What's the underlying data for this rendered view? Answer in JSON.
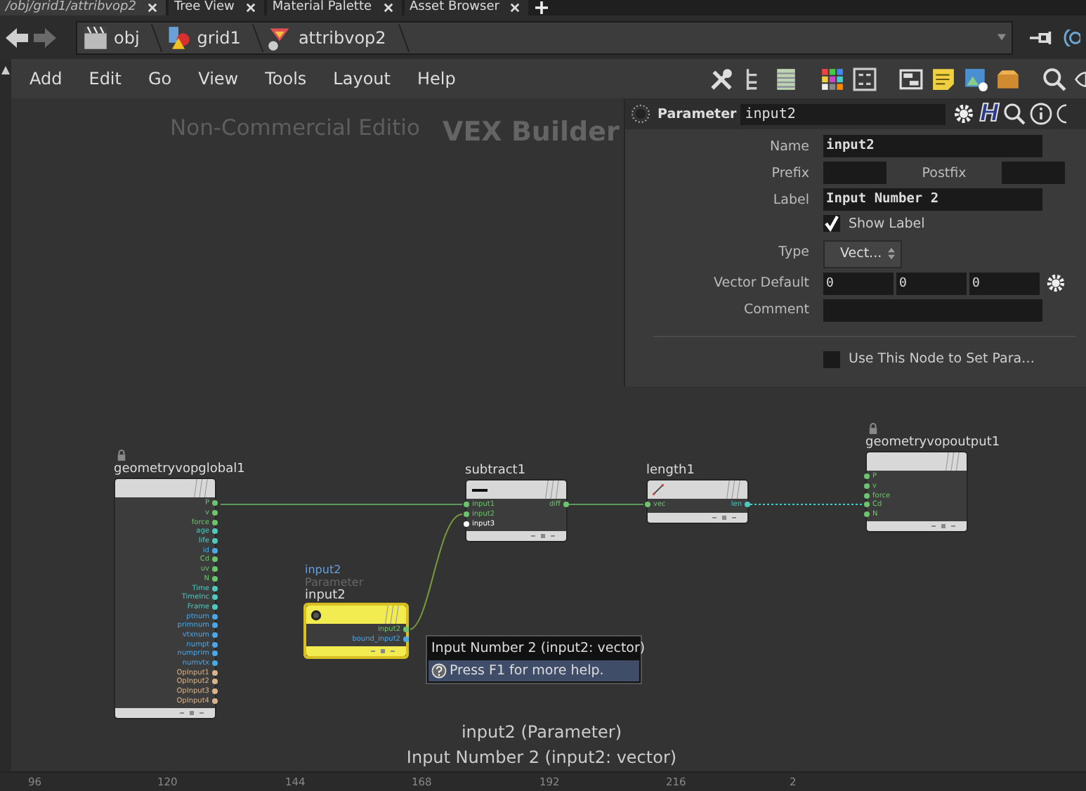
{
  "tabs": [
    {
      "label": "/obj/grid1/attribvop2",
      "selected": true
    },
    {
      "label": "Tree View",
      "selected": false
    },
    {
      "label": "Material Palette",
      "selected": false
    },
    {
      "label": "Asset Browser",
      "selected": false
    }
  ],
  "path": [
    "obj",
    "grid1",
    "attribvop2"
  ],
  "menu": [
    "Add",
    "Edit",
    "Go",
    "View",
    "Tools",
    "Layout",
    "Help"
  ],
  "canvas": {
    "watermark": "Non-Commercial Editio",
    "context": "VEX Builder"
  },
  "parameter_panel": {
    "type_label": "Parameter",
    "node_name": "input2",
    "hda_glyph": "H",
    "name": {
      "label": "Name",
      "value": "input2"
    },
    "prefix": {
      "label": "Prefix"
    },
    "postfix": {
      "label": "Postfix"
    },
    "label": {
      "label": "Label",
      "value": "Input Number 2"
    },
    "show_label": {
      "label": "Show Label",
      "checked": true
    },
    "type": {
      "label": "Type",
      "value": "Vect..."
    },
    "vector_default": {
      "label": "Vector Default",
      "values": [
        "0",
        "0",
        "0"
      ]
    },
    "comment": {
      "label": "Comment"
    },
    "use_node": {
      "label": "Use This Node to Set Para…",
      "checked": false
    }
  },
  "nodes": [
    {
      "name": "geometryvopglobal1",
      "kind": "global",
      "locked": true,
      "selected": false,
      "outputs": [
        {
          "name": "P",
          "color": "#6cc46c"
        },
        {
          "name": "v",
          "color": "#6cc46c"
        },
        {
          "name": "force",
          "color": "#6cc46c"
        },
        {
          "name": "age",
          "color": "#4fc9c0"
        },
        {
          "name": "life",
          "color": "#4fc9c0"
        },
        {
          "name": "id",
          "color": "#4aa8e8"
        },
        {
          "name": "Cd",
          "color": "#6cc46c"
        },
        {
          "name": "uv",
          "color": "#6cc46c"
        },
        {
          "name": "N",
          "color": "#6cc46c"
        },
        {
          "name": "Time",
          "color": "#4fc9c0"
        },
        {
          "name": "TimeInc",
          "color": "#4fc9c0"
        },
        {
          "name": "Frame",
          "color": "#4fc9c0"
        },
        {
          "name": "ptnum",
          "color": "#4aa8e8"
        },
        {
          "name": "primnum",
          "color": "#4aa8e8"
        },
        {
          "name": "vtxnum",
          "color": "#4aa8e8"
        },
        {
          "name": "numpt",
          "color": "#4aa8e8"
        },
        {
          "name": "numprim",
          "color": "#4aa8e8"
        },
        {
          "name": "numvtx",
          "color": "#4aa8e8"
        },
        {
          "name": "OpInput1",
          "color": "#d9b48c"
        },
        {
          "name": "OpInput2",
          "color": "#d9b48c"
        },
        {
          "name": "OpInput3",
          "color": "#d9b48c"
        },
        {
          "name": "OpInput4",
          "color": "#d9b48c"
        }
      ]
    },
    {
      "name": "subtract1",
      "kind": "subtract",
      "locked": false,
      "selected": false,
      "inputs": [
        {
          "name": "input1",
          "color": "#6cc46c"
        },
        {
          "name": "input2",
          "color": "#6cc46c"
        },
        {
          "name": "input3",
          "color": "#ffffff"
        }
      ],
      "outputs": [
        {
          "name": "diff",
          "color": "#6cc46c"
        }
      ]
    },
    {
      "name": "length1",
      "kind": "length",
      "locked": false,
      "selected": false,
      "inputs": [
        {
          "name": "vec",
          "color": "#6cc46c"
        }
      ],
      "outputs": [
        {
          "name": "len",
          "color": "#4fc9c0"
        }
      ]
    },
    {
      "name": "geometryvopoutput1",
      "kind": "output",
      "locked": true,
      "selected": false,
      "inputs": [
        {
          "name": "P",
          "color": "#6cc46c"
        },
        {
          "name": "v",
          "color": "#6cc46c"
        },
        {
          "name": "force",
          "color": "#6cc46c"
        },
        {
          "name": "Cd",
          "color": "#6cc46c"
        },
        {
          "name": "N",
          "color": "#6cc46c"
        }
      ]
    },
    {
      "name": "input2",
      "kind": "parameter",
      "locked": false,
      "selected": true,
      "caption_name": "input2",
      "caption_type": "Parameter",
      "outputs": [
        {
          "name": "input2",
          "color": "#6cc46c"
        },
        {
          "name": "bound_input2",
          "color": "#4aa8e8"
        }
      ]
    }
  ],
  "tooltip": {
    "title": "Input Number 2 (input2: vector)",
    "help": "Press F1 for more help."
  },
  "status": [
    "input2 (Parameter)",
    "Input Number 2 (input2: vector)"
  ],
  "ruler": [
    "96",
    "120",
    "144",
    "168",
    "192",
    "216",
    "2"
  ]
}
